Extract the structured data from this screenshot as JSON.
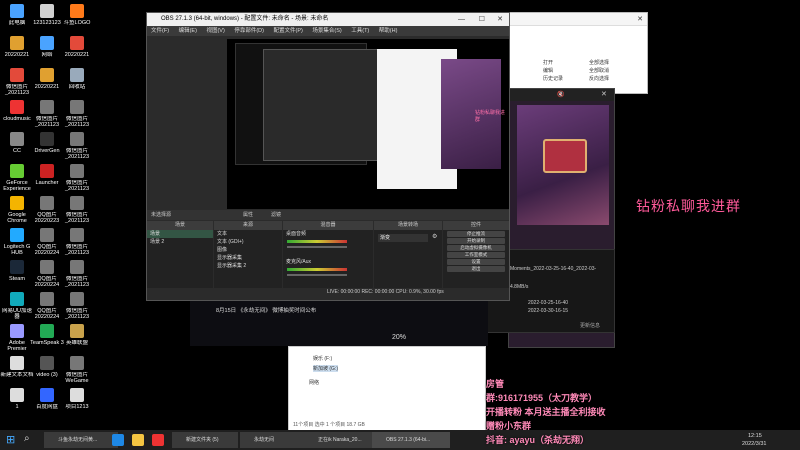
{
  "desktop": {
    "icons": [
      {
        "label": "此电脑",
        "color": "#4aa3ff"
      },
      {
        "label": "123123123",
        "color": "#d0d0d0"
      },
      {
        "label": "斗鱼LOGO",
        "color": "#ff7a1a"
      },
      {
        "label": "20220221",
        "color": "#e0a030"
      },
      {
        "label": "网络",
        "color": "#4aa3ff"
      },
      {
        "label": "20220221",
        "color": "#e34a3a"
      },
      {
        "label": "微信图片_2021123",
        "color": "#e34a3a"
      },
      {
        "label": "20220221",
        "color": "#e0a030"
      },
      {
        "label": "回收站",
        "color": "#9ab"
      },
      {
        "label": "cloudmusic",
        "color": "#e33"
      },
      {
        "label": "微信图片_2021123",
        "color": "#777"
      },
      {
        "label": "微信图片_2021123",
        "color": "#777"
      },
      {
        "label": "CC",
        "color": "#888"
      },
      {
        "label": "DriverGen",
        "color": "#333"
      },
      {
        "label": "微信图片_2021123",
        "color": "#777"
      },
      {
        "label": "GeForce Experience",
        "color": "#6c3"
      },
      {
        "label": "Launcher",
        "color": "#c22"
      },
      {
        "label": "微信图片_2021123",
        "color": "#777"
      },
      {
        "label": "Google Chrome",
        "color": "#f4b400"
      },
      {
        "label": "QQ图片20220223",
        "color": "#777"
      },
      {
        "label": "微信图片_2021123",
        "color": "#777"
      },
      {
        "label": "Logitech G HUB",
        "color": "#2af"
      },
      {
        "label": "QQ图片20220224",
        "color": "#777"
      },
      {
        "label": "微信图片_2021123",
        "color": "#777"
      },
      {
        "label": "Steam",
        "color": "#1b2838"
      },
      {
        "label": "QQ图片20220224",
        "color": "#777"
      },
      {
        "label": "微信图片_2021123",
        "color": "#777"
      },
      {
        "label": "网易UU加速器",
        "color": "#1ab"
      },
      {
        "label": "QQ图片20220224",
        "color": "#777"
      },
      {
        "label": "微信图片_2021123",
        "color": "#777"
      },
      {
        "label": "Adobe Premier",
        "color": "#9999ff"
      },
      {
        "label": "TeamSpeak 3",
        "color": "#2a5"
      },
      {
        "label": "英雄联盟",
        "color": "#c9a24b"
      },
      {
        "label": "新建文本文档",
        "color": "#ddd"
      },
      {
        "label": "video (3)",
        "color": "#555"
      },
      {
        "label": "微信图片 WeGame",
        "color": "#777"
      },
      {
        "label": "1",
        "color": "#ddd"
      },
      {
        "label": "百度网盘",
        "color": "#36f"
      },
      {
        "label": "项目1213",
        "color": "#ddd"
      }
    ]
  },
  "obs": {
    "title": "OBS 27.1.3 (64-bit, windows) - 配置文件: 未命名 - 场景: 未命名",
    "menu": [
      "文件(F)",
      "编辑(E)",
      "视图(V)",
      "停靠部件(D)",
      "配置文件(P)",
      "场景集合(S)",
      "工具(T)",
      "帮助(H)"
    ],
    "no_source_selected": "未选择源",
    "properties_btn": "属性",
    "filters_btn": "滤镜",
    "docks": {
      "scenes": "场景",
      "sources": "来源",
      "mixer": "混音器",
      "transitions": "场景转场",
      "controls": "控件"
    },
    "scenes": [
      "场景",
      "场景 2"
    ],
    "sources": [
      "文本",
      "文本 (GDI+)",
      "图像",
      "显示器采集",
      "显示器采集 2"
    ],
    "mixer": [
      "桌面音频",
      "麦克风/Aux"
    ],
    "transition": "渐变",
    "controls": [
      "停止推流",
      "开始录制",
      "启动虚拟摄像机",
      "工作室模式",
      "设置",
      "退出"
    ],
    "status": "LIVE: 00:00:00   REC: 00:00:00   CPU: 0.9%, 30.00 fps"
  },
  "stream_overlay": {
    "vertical_text": "钻粉私聊我进群",
    "side_text": "钻粉私聊我进群",
    "percent": "20%",
    "lines": [
      "房管",
      "群:916171955（太刀教学）",
      "开播转粉 本月送主播全利接收",
      "赠粉小东群",
      "抖音: ayayu（杀劫无翔）"
    ]
  },
  "explorer": {
    "items": [
      "打开",
      "编辑",
      "历史记录",
      "全部选择",
      "全部取消",
      "反向选择"
    ],
    "sidebar": [
      "娱乐 (F:)",
      "新加坡 (G:)",
      "网络"
    ],
    "status": "11个项目  选中 1 个项目  18.7 GB"
  },
  "rec_panel": {
    "filename": "Moments_2022-03-25-16-40_2022-03-",
    "size": "4.8MB/s",
    "date1": "2022-03-25-16-40",
    "date2": "2022-03-30-16-15",
    "btn": "更新信息"
  },
  "bulletin": "8月15日 《永劫无间》 微博抽奖时间公布",
  "taskbar": {
    "items": [
      "斗鱼永劫无间黄...",
      "新建文件夹 (5)",
      "永劫无间",
      "正在ik Naraka_20...",
      "OBS 27.1.3 (64-bi..."
    ],
    "time": "12:15",
    "date": "2022/3/31"
  }
}
